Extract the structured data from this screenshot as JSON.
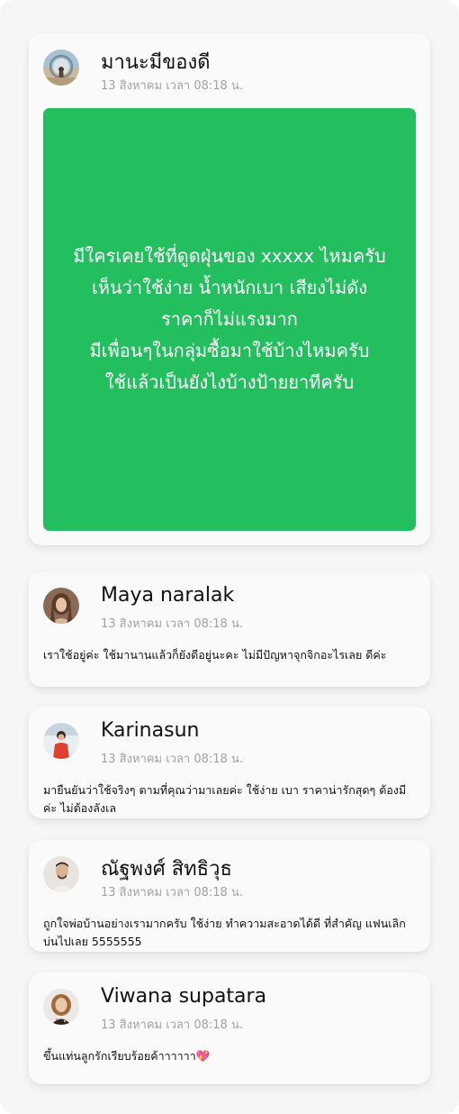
{
  "post": {
    "author": "มานะมีของดี",
    "time": "13 สิงหาคม เวลา 08:18 น.",
    "text": "มีใครเคยใช้ที่ดูดฝุ่นของ xxxxx ไหมครับ\nเห็นว่าใช้ง่าย น้ำหนักเบา เสียงไม่ดัง\nราคาก็ไม่แรงมาก\nมีเพื่อนๆในกลุ่มซื้อมาใช้บ้างไหมครับ\nใช้แล้วเป็นยังไงบ้างป้ายยาทีครับ",
    "background_color": "#23bf5f"
  },
  "comments": [
    {
      "author": "Maya naralak",
      "time": "13 สิงหาคม เวลา 08:18 น.",
      "text": "เราใช้อยู่ค่ะ ใช้มานานแล้วก็ยังดีอยู่นะคะ ไม่มีปัญหาจุกจิกอะไรเลย ดีค่ะ"
    },
    {
      "author": "Karinasun",
      "time": "13 สิงหาคม เวลา 08:18 น.",
      "text": "มายืนยันว่าใช้จริงๆ ตามที่คุณว่ามาเลยค่ะ ใช้ง่าย เบา ราคาน่ารักสุดๆ ต้องมีค่ะ ไม่ต้องลังเล"
    },
    {
      "author": "ณัฐพงศ์ สิทธิวุธ",
      "time": "13 สิงหาคม เวลา 08:18 น.",
      "text": "ถูกใจพ่อบ้านอย่างเรามากครับ ใช้ง่าย ทำความสะอาดได้ดี ที่สำคัญ แฟนเลิกบ่นไปเลย 5555555"
    },
    {
      "author": "Viwana supatara",
      "time": "13 สิงหาคม เวลา 08:18 น.",
      "text": "ขึ้นแท่นลูกรักเรียบร้อยค้าาาาาา💖"
    }
  ]
}
